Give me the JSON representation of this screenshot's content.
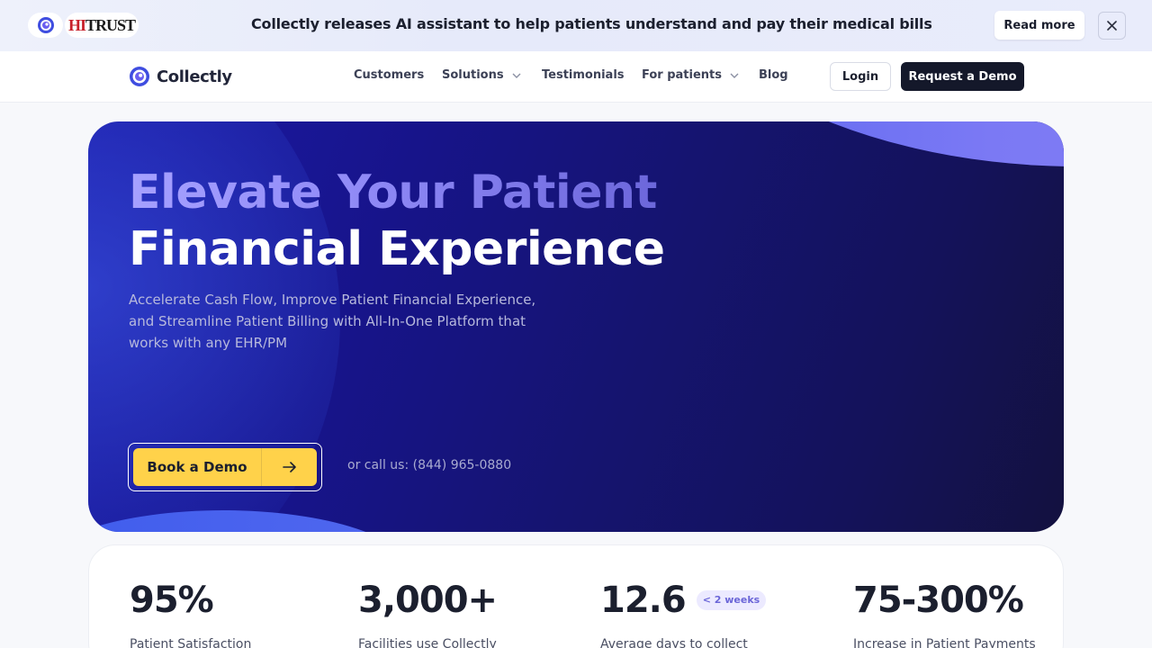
{
  "announcement": {
    "hitrust_prefix": "HI",
    "hitrust_suffix": "TRUST",
    "text": "Collectly releases AI assistant to help patients understand and pay their medical bills",
    "read_more_label": "Read more",
    "close_icon": "×"
  },
  "nav": {
    "brand": "Collectly",
    "links": [
      {
        "label": "Customers",
        "has_dropdown": false
      },
      {
        "label": "Solutions",
        "has_dropdown": true
      },
      {
        "label": "Testimonials",
        "has_dropdown": false
      },
      {
        "label": "For patients",
        "has_dropdown": true
      },
      {
        "label": "Blog",
        "has_dropdown": false
      }
    ],
    "login_label": "Login",
    "demo_label": "Request a Demo"
  },
  "hero": {
    "title_line1": "Elevate Your Patient",
    "title_line2": "Financial Experience",
    "subtitle": "Accelerate Cash Flow, Improve Patient Financial Experience, and Streamline Patient Billing with All-In-One Platform that works with any EHR/PM",
    "cta_label": "Book a Demo",
    "call_text": "or call us: (844) 965-0880"
  },
  "stats": [
    {
      "value": "95%",
      "label": "Patient Satisfaction",
      "tag": ""
    },
    {
      "value": "3,000+",
      "label": "Facilities use Collectly",
      "tag": ""
    },
    {
      "value": "12.6",
      "label": "Average days to collect",
      "tag": "< 2 weeks"
    },
    {
      "value": "75-300%",
      "label": "Increase in Patient Payments",
      "tag": ""
    }
  ],
  "colors": {
    "brand_dark": "#14182a",
    "cta_yellow": "#ffd24a",
    "hero_navy": "#17148a",
    "accent_purple": "#8c84f6"
  }
}
